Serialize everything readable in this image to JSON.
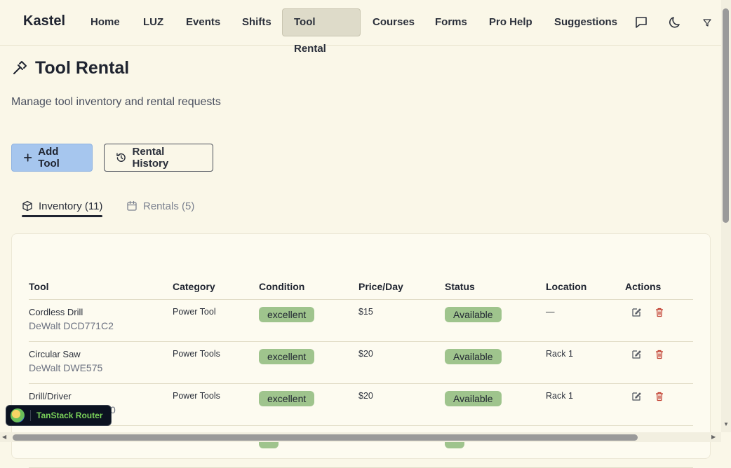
{
  "nav": {
    "brand": "Kastel",
    "items": [
      {
        "label": "Home"
      },
      {
        "label": "LUZ"
      },
      {
        "label": "Events"
      },
      {
        "label": "Shifts"
      },
      {
        "label": "Tool Rental",
        "active": true
      },
      {
        "label": "Courses"
      },
      {
        "label": "Forms"
      },
      {
        "label": "Pro Help"
      },
      {
        "label": "Suggestions"
      }
    ],
    "icons": [
      "message-icon",
      "moon-icon",
      "filter-icon"
    ]
  },
  "page": {
    "title": "Tool Rental",
    "subtitle": "Manage tool inventory and rental requests"
  },
  "actions": {
    "add_tool": "Add Tool",
    "rental_history": "Rental History"
  },
  "tabs": [
    {
      "label": "Inventory (11)",
      "active": true
    },
    {
      "label": "Rentals (5)",
      "active": false
    }
  ],
  "table": {
    "columns": [
      "Tool",
      "Category",
      "Condition",
      "Price/Day",
      "Status",
      "Location",
      "Actions"
    ],
    "rows": [
      {
        "name": "Cordless Drill",
        "model": "DeWalt DCD771C2",
        "category": "Power Tool",
        "condition": "excellent",
        "price": "$15",
        "status": "Available",
        "location": "—"
      },
      {
        "name": "Circular Saw",
        "model": "DeWalt DWE575",
        "category": "Power Tools",
        "condition": "excellent",
        "price": "$20",
        "status": "Available",
        "location": "Rack 1"
      },
      {
        "name": "Drill/Driver",
        "model": "0",
        "category": "Power Tools",
        "condition": "excellent",
        "price": "$20",
        "status": "Available",
        "location": "Rack 1"
      }
    ]
  },
  "devtools": {
    "label": "TanStack Router"
  },
  "colors": {
    "background": "#faf7e8",
    "primary_button": "#a6c6ee",
    "pill_green": "#9fc48d",
    "delete_red": "#c0392b"
  }
}
